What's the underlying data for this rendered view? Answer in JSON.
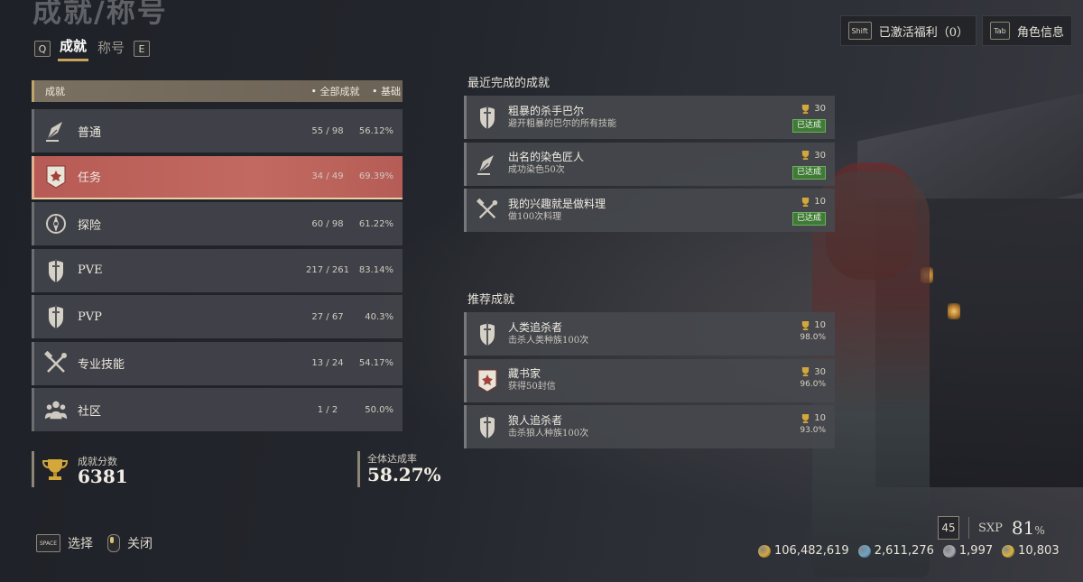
{
  "header": {
    "title": "成就/称号",
    "key_left": "Q",
    "key_right": "E",
    "tabs": [
      {
        "label": "成就",
        "active": true
      },
      {
        "label": "称号",
        "active": false
      }
    ]
  },
  "top_right": {
    "benefits_key": "Shift",
    "benefits_label": "已激活福利（0）",
    "character_key": "Tab",
    "character_label": "角色信息"
  },
  "categories": {
    "header_label": "成就",
    "filters": [
      "• 全部成就",
      "• 基础"
    ],
    "items": [
      {
        "name": "普通",
        "count": "55 / 98",
        "pct": "56.12%",
        "icon": "quill-icon",
        "selected": false
      },
      {
        "name": "任务",
        "count": "34 / 49",
        "pct": "69.39%",
        "icon": "quest-emblem-icon",
        "selected": true
      },
      {
        "name": "探险",
        "count": "60 / 98",
        "pct": "61.22%",
        "icon": "compass-icon",
        "selected": false
      },
      {
        "name": "PVE",
        "count": "217 / 261",
        "pct": "83.14%",
        "icon": "sword-shield-icon",
        "selected": false
      },
      {
        "name": "PVP",
        "count": "27 / 67",
        "pct": "40.3%",
        "icon": "sword-shield-icon",
        "selected": false
      },
      {
        "name": "专业技能",
        "count": "13 / 24",
        "pct": "54.17%",
        "icon": "crossed-tools-icon",
        "selected": false
      },
      {
        "name": "社区",
        "count": "1 / 2",
        "pct": "50.0%",
        "icon": "community-icon",
        "selected": false
      }
    ]
  },
  "summary": {
    "score_label": "成就分数",
    "score_value": "6381",
    "rate_label": "全体达成率",
    "rate_value": "58.27%"
  },
  "bottom_controls": {
    "select_key": "SPACE",
    "select_label": "选择",
    "close_label": "关闭"
  },
  "recent": {
    "title": "最近完成的成就",
    "items": [
      {
        "name": "粗暴的杀手巴尔",
        "desc": "避开粗暴的巴尔的所有技能",
        "points": "30",
        "badge": "已达成",
        "icon": "sword-shield-icon"
      },
      {
        "name": "出名的染色匠人",
        "desc": "成功染色50次",
        "points": "30",
        "badge": "已达成",
        "icon": "quill-icon"
      },
      {
        "name": "我的兴趣就是做料理",
        "desc": "做100次料理",
        "points": "10",
        "badge": "已达成",
        "icon": "crossed-tools-icon"
      }
    ]
  },
  "recommended": {
    "title": "推荐成就",
    "items": [
      {
        "name": "人类追杀者",
        "desc": "击杀人类种族100次",
        "points": "10",
        "pct": "98.0%",
        "icon": "sword-shield-icon"
      },
      {
        "name": "藏书家",
        "desc": "获得50封信",
        "points": "30",
        "pct": "96.0%",
        "icon": "quest-emblem-icon"
      },
      {
        "name": "狼人追杀者",
        "desc": "击杀狼人种族100次",
        "points": "10",
        "pct": "93.0%",
        "icon": "sword-shield-icon"
      }
    ]
  },
  "status": {
    "level": "45",
    "sxp_label": "SXP",
    "sxp_value": "81",
    "sxp_unit": "%",
    "currencies": [
      {
        "icon": "gold-coin-icon",
        "value": "106,482,619",
        "color": "#d4a73a"
      },
      {
        "icon": "blue-gem-icon",
        "value": "2,611,276",
        "color": "#6fa3c8"
      },
      {
        "icon": "silver-stone-icon",
        "value": "1,997",
        "color": "#a8aab0"
      },
      {
        "icon": "gold-gear-icon",
        "value": "10,803",
        "color": "#d9b23c"
      }
    ]
  },
  "colors": {
    "accent_gold": "#c5a45b",
    "selected_row": "#c26a62",
    "badge_green": "#3f7a37"
  }
}
